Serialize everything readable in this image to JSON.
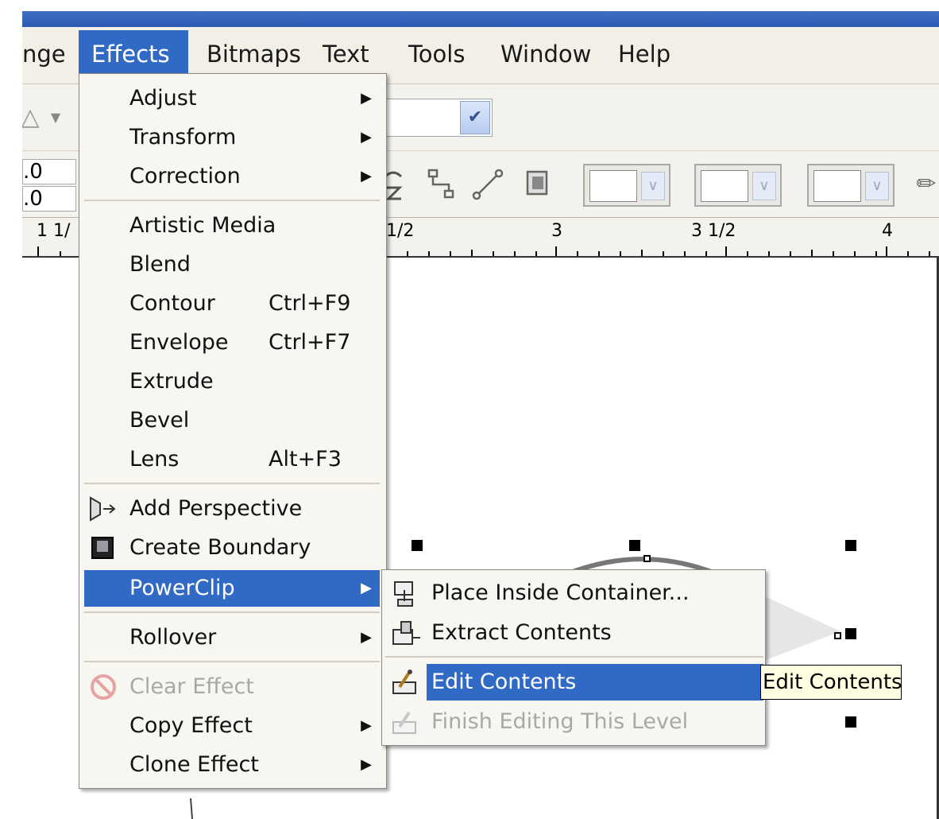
{
  "menubar": {
    "items": [
      "nge",
      "Effects",
      "Bitmaps",
      "Text",
      "Tools",
      "Window",
      "Help"
    ],
    "active": "Effects"
  },
  "toolbar": {
    "x_value": ".0",
    "y_value": ".0"
  },
  "ruler": {
    "labels": [
      "1  1/",
      "1/2",
      "3",
      "3  1/2",
      "4"
    ]
  },
  "effects_menu": {
    "items": [
      {
        "label": "Adjust",
        "submenu": true
      },
      {
        "label": "Transform",
        "submenu": true
      },
      {
        "label": "Correction",
        "submenu": true
      },
      {
        "label": "Artistic Media"
      },
      {
        "label": "Blend"
      },
      {
        "label": "Contour",
        "shortcut": "Ctrl+F9"
      },
      {
        "label": "Envelope",
        "shortcut": "Ctrl+F7"
      },
      {
        "label": "Extrude"
      },
      {
        "label": "Bevel"
      },
      {
        "label": "Lens",
        "shortcut": "Alt+F3"
      },
      {
        "label": "Add Perspective",
        "icon": "perspective-icon"
      },
      {
        "label": "Create Boundary",
        "icon": "boundary-icon"
      },
      {
        "label": "PowerClip",
        "submenu": true,
        "highlighted": true
      },
      {
        "label": "Rollover",
        "submenu": true
      },
      {
        "label": "Clear Effect",
        "disabled": true,
        "icon": "clear-effect-icon"
      },
      {
        "label": "Copy Effect",
        "submenu": true
      },
      {
        "label": "Clone Effect",
        "submenu": true
      }
    ]
  },
  "powerclip_submenu": {
    "items": [
      {
        "label": "Place Inside Container...",
        "icon": "place-inside-icon"
      },
      {
        "label": "Extract Contents",
        "icon": "extract-icon"
      },
      {
        "label": "Edit Contents",
        "icon": "edit-contents-icon",
        "highlighted": true
      },
      {
        "label": "Finish Editing This Level",
        "icon": "finish-editing-icon",
        "disabled": true
      }
    ]
  },
  "tooltip": {
    "text": "Edit Contents"
  },
  "colors": {
    "menu_highlight": "#316ac5",
    "title_bar": "#2d5ab4",
    "disabled_text": "#a8a8a8"
  }
}
